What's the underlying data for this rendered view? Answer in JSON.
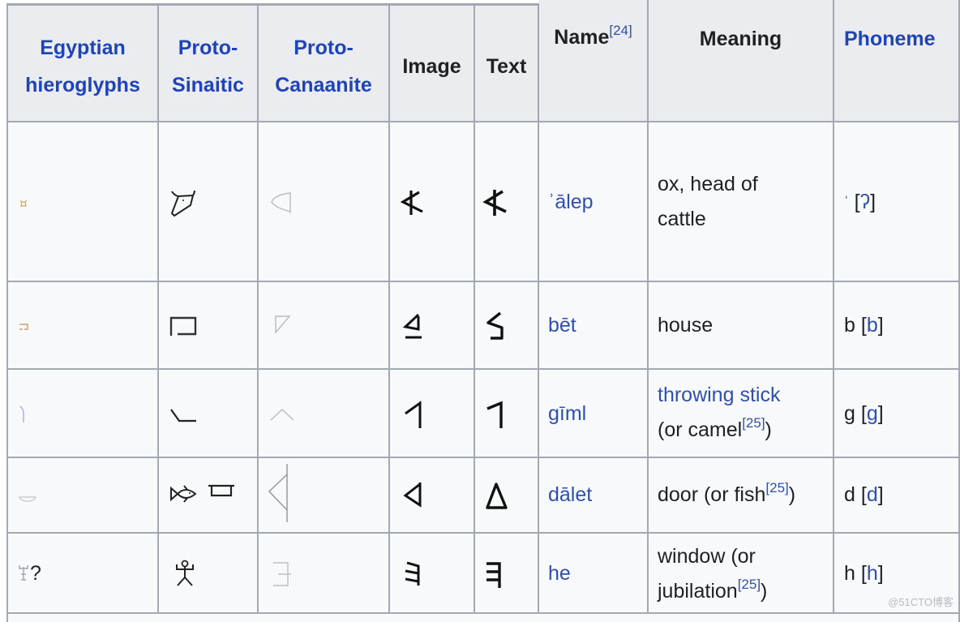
{
  "table": {
    "headers": {
      "egyptian": [
        "Egyptian",
        "hieroglyphs"
      ],
      "proto_sinaitic": [
        "Proto-",
        "Sinaitic"
      ],
      "proto_canaanite": [
        "Proto-",
        "Canaanite"
      ],
      "image": "Image",
      "text": "Text",
      "name": "Name",
      "name_ref": "[24]",
      "meaning": "Meaning",
      "phoneme": "Phoneme"
    },
    "colors": {
      "link": "#2f50b0",
      "header_bg": "#eaecf0",
      "cell_bg": "#f8f9fa",
      "border": "#a2a9b1",
      "text": "#202122"
    },
    "rows": [
      {
        "egyptian_glyph": "ox-head-hieroglyph-icon",
        "sinaitic_glyph": "ox-head-icon",
        "canaanite_glyph": "aleph-canaanite-icon",
        "image_glyph": "aleph-phoenician-icon",
        "text_glyph": "𐤀",
        "name": "ʾālep",
        "meaning": [
          "ox, head of",
          "cattle"
        ],
        "meaning_ref": "",
        "phoneme_plain": "ʾ",
        "phoneme_ipa": "ʔ"
      },
      {
        "egyptian_glyph": "house-hieroglyph-icon",
        "sinaitic_glyph": "house-icon",
        "canaanite_glyph": "bet-canaanite-icon",
        "image_glyph": "bet-phoenician-icon",
        "text_glyph": "𐤁",
        "name": "bēt",
        "meaning": [
          "house"
        ],
        "meaning_ref": "",
        "phoneme_plain": "b",
        "phoneme_ipa": "b"
      },
      {
        "egyptian_glyph": "throwing-stick-hieroglyph-icon",
        "sinaitic_glyph": "throwing-stick-icon",
        "canaanite_glyph": "gimel-canaanite-icon",
        "image_glyph": "gimel-phoenician-icon",
        "text_glyph": "𐤂",
        "name": "gīml",
        "meaning_link": "throwing stick",
        "meaning": [
          "(or camel",
          ")"
        ],
        "meaning_ref": "[25]",
        "phoneme_plain": "g",
        "phoneme_ipa": "g"
      },
      {
        "egyptian_glyph": "door-hieroglyph-icon",
        "sinaitic_glyph": "fish-and-door-icon",
        "canaanite_glyph": "dalet-canaanite-icon",
        "image_glyph": "dalet-phoenician-icon",
        "text_glyph": "𐤃",
        "name": "dālet",
        "meaning": [
          "door (or fish",
          ")"
        ],
        "meaning_ref": "[25]",
        "phoneme_plain": "d",
        "phoneme_ipa": "d"
      },
      {
        "egyptian_glyph": "jubilation-hieroglyph-icon",
        "egyptian_suffix": "?",
        "sinaitic_glyph": "jubilating-man-icon",
        "canaanite_glyph": "he-canaanite-icon",
        "image_glyph": "he-phoenician-icon",
        "text_glyph": "𐤄",
        "name": "he",
        "meaning": [
          "window (or",
          "jubilation",
          ")"
        ],
        "meaning_ref": "[25]",
        "phoneme_plain": "h",
        "phoneme_ipa": "h"
      }
    ]
  },
  "watermark": "@51CTO博客"
}
